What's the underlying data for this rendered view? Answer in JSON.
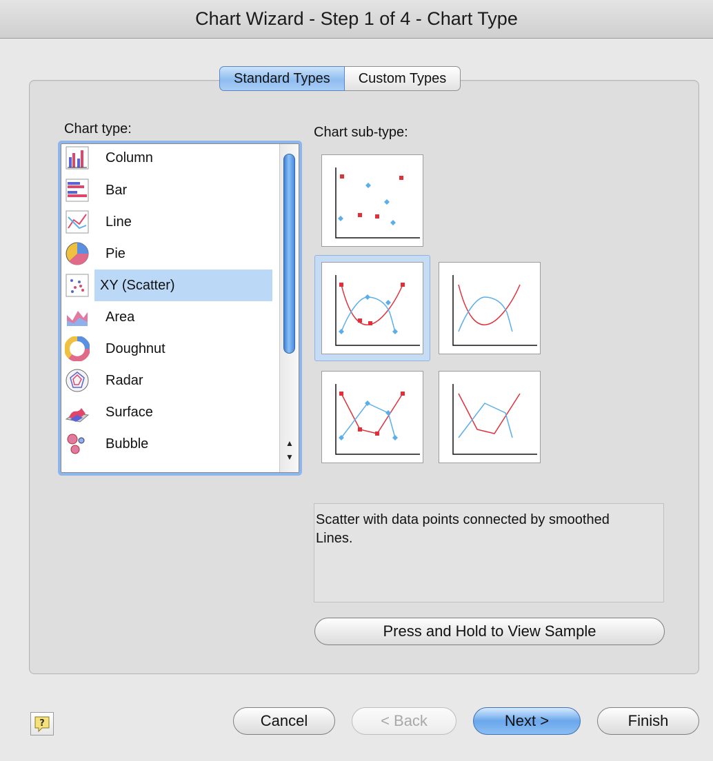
{
  "window": {
    "title": "Chart Wizard - Step 1 of 4 - Chart Type"
  },
  "tabs": [
    {
      "label": "Standard Types",
      "active": true
    },
    {
      "label": "Custom Types",
      "active": false
    }
  ],
  "chart_type": {
    "label": "Chart type:",
    "selected": "XY (Scatter)",
    "items": [
      {
        "label": "Column",
        "icon": "column-chart-icon"
      },
      {
        "label": "Bar",
        "icon": "bar-chart-icon"
      },
      {
        "label": "Line",
        "icon": "line-chart-icon"
      },
      {
        "label": "Pie",
        "icon": "pie-chart-icon"
      },
      {
        "label": "XY (Scatter)",
        "icon": "scatter-chart-icon"
      },
      {
        "label": "Area",
        "icon": "area-chart-icon"
      },
      {
        "label": "Doughnut",
        "icon": "doughnut-chart-icon"
      },
      {
        "label": "Radar",
        "icon": "radar-chart-icon"
      },
      {
        "label": "Surface",
        "icon": "surface-chart-icon"
      },
      {
        "label": "Bubble",
        "icon": "bubble-chart-icon"
      }
    ]
  },
  "chart_subtype": {
    "label": "Chart sub-type:",
    "items": [
      {
        "name": "scatter-markers-only"
      },
      {
        "name": "scatter-smoothed-lines-markers",
        "selected": true
      },
      {
        "name": "scatter-smoothed-lines"
      },
      {
        "name": "scatter-straight-lines-markers"
      },
      {
        "name": "scatter-straight-lines"
      }
    ]
  },
  "description": "Scatter with data points connected by smoothed Lines.",
  "buttons": {
    "sample": "Press and Hold to View Sample",
    "cancel": "Cancel",
    "back": "< Back",
    "next": "Next >",
    "finish": "Finish",
    "help_icon": "help-icon"
  },
  "colors": {
    "series_red": "#e0303a",
    "series_blue": "#5aaeea",
    "selection": "#bcd8f7",
    "accent": "#6aa7ec"
  }
}
